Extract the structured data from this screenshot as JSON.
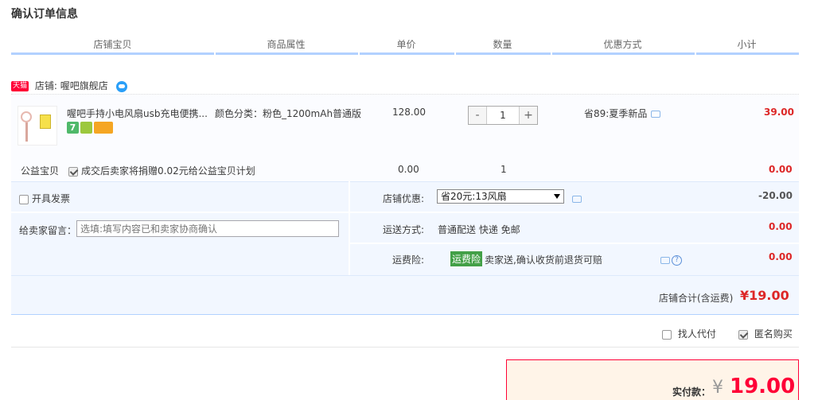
{
  "page": {
    "title": "确认订单信息"
  },
  "columns": [
    "店铺宝贝",
    "商品属性",
    "单价",
    "数量",
    "优惠方式",
    "小计"
  ],
  "shop": {
    "badge": "天猫",
    "label": "店铺: 喔吧旗舰店"
  },
  "item": {
    "name": "喔吧手持小电风扇usb充电便携...",
    "badge_seven": "7",
    "attribute": "颜色分类：粉色_1200mAh普通版",
    "price": "128.00",
    "quantity": "1",
    "minus": "-",
    "plus": "+",
    "promo": "省89:夏季新品",
    "subtotal": "39.00"
  },
  "charity": {
    "label": "公益宝贝",
    "text": "成交后卖家将捐赠0.02元给公益宝贝计划",
    "price": "0.00",
    "quantity": "1",
    "subtotal": "0.00"
  },
  "options": {
    "invoice_label": "开具发票",
    "note_label": "给卖家留言：",
    "note_placeholder": "选填:填写内容已和卖家协商确认",
    "discount_label": "店铺优惠:",
    "discount_selected": "省20元:13风扇",
    "discount_value": "-20.00",
    "shipping_label": "运送方式:",
    "shipping_value": "普通配送 快递 免邮",
    "shipping_fee": "0.00",
    "insurance_label": "运费险:",
    "insurance_tag": "运费险",
    "insurance_text": "卖家送,确认收货前退货可赔",
    "insurance_fee": "0.00",
    "help_icon": "?"
  },
  "total": {
    "label": "店铺合计(含运费)",
    "value": "¥19.00"
  },
  "checkout": {
    "proxy_label": "找人代付",
    "anon_label": "匿名购买",
    "pay_label": "实付款：",
    "currency": "¥",
    "pay_value": "19.00"
  },
  "colors": {
    "accent": "#dd2727",
    "header_line": "#b2d1ff",
    "panel": "#f2f7ff",
    "tmall_red": "#ff0036"
  }
}
